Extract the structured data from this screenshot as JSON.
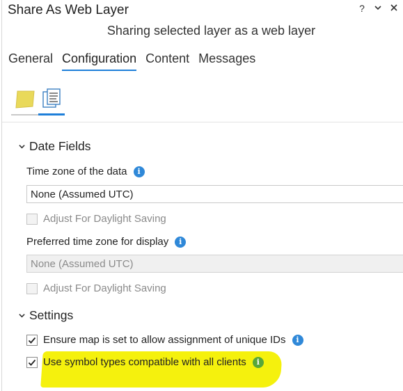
{
  "window": {
    "title": "Share As Web Layer",
    "help_glyph": "?",
    "menu_icon": "chevron-down-icon",
    "close_icon": "close-icon"
  },
  "subtitle": "Sharing selected layer as a web layer",
  "tabs": [
    {
      "label": "General",
      "active": false
    },
    {
      "label": "Configuration",
      "active": true
    },
    {
      "label": "Content",
      "active": false
    },
    {
      "label": "Messages",
      "active": false
    }
  ],
  "subtabs": [
    {
      "icon": "layer-icon",
      "active": false
    },
    {
      "icon": "properties-icon",
      "active": true
    }
  ],
  "date_fields": {
    "header": "Date Fields",
    "time_zone_label": "Time zone of the data",
    "time_zone_value": "None (Assumed UTC)",
    "daylight_1": "Adjust For Daylight Saving",
    "preferred_label": "Preferred time zone for display",
    "preferred_value": "None (Assumed UTC)",
    "daylight_2": "Adjust For Daylight Saving"
  },
  "settings": {
    "header": "Settings",
    "unique_ids": "Ensure map is set to allow assignment of unique IDs",
    "symbol_types": "Use symbol types compatible with all clients"
  },
  "colors": {
    "accent": "#1e7fd9",
    "info_blue": "#2f88d8",
    "info_green": "#58a63a",
    "highlight": "#f4f000"
  }
}
